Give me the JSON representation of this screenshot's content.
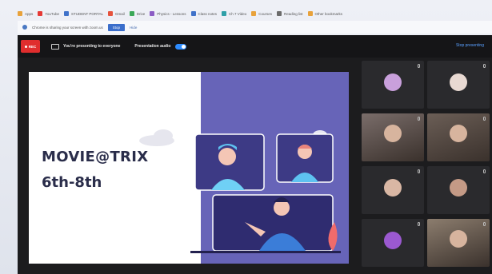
{
  "browser": {
    "bookmarks": [
      {
        "label": "Apps",
        "color": "#e8a23b"
      },
      {
        "label": "YouTube",
        "color": "#e53935"
      },
      {
        "label": "STUDENT PORTAL",
        "color": "#3f72c9"
      },
      {
        "label": "Gmail",
        "color": "#e5533d"
      },
      {
        "label": "Drive",
        "color": "#3aa757"
      },
      {
        "label": "Physics - Lessons",
        "color": "#8b5cc4"
      },
      {
        "label": "Class notes",
        "color": "#3f72c9"
      },
      {
        "label": "Ch 7 Video",
        "color": "#2fa0a8"
      },
      {
        "label": "Courses",
        "color": "#e8a23b"
      },
      {
        "label": "Reading list",
        "color": "#6b6b6b"
      },
      {
        "label": "Other bookmarks",
        "color": "#e8a23b"
      }
    ]
  },
  "notification": {
    "text": "Chrome is sharing your screen with zoom.us",
    "button": "Stop",
    "link": "Hide"
  },
  "zoom": {
    "rec_label": "REC",
    "presenting_text": "You're presenting to everyone",
    "audio_text": "Presentation audio",
    "stop_share": "Stop presenting"
  },
  "slide": {
    "title": "MOVIE@TRIX",
    "subtitle": "6th-8th"
  },
  "participants": [
    {
      "name": "",
      "kind": "avatar",
      "color": "#c9a0dc"
    },
    {
      "name": "",
      "kind": "avatar",
      "color": "#e8d9d2"
    },
    {
      "name": "",
      "kind": "video",
      "color": "#7a6d6a"
    },
    {
      "name": "",
      "kind": "video",
      "color": "#6b5e56"
    },
    {
      "name": "",
      "kind": "avatar",
      "color": "#d9b7a4"
    },
    {
      "name": "",
      "kind": "avatar",
      "color": "#c49a86"
    },
    {
      "name": "",
      "kind": "avatar",
      "color": "#9b59d0"
    },
    {
      "name": "",
      "kind": "video",
      "color": "#8c7d6e"
    }
  ],
  "colors": {
    "accent": "#2d8cff",
    "rec": "#e02d2d",
    "slide_purple": "#6764b8",
    "slide_text": "#2a2d4a"
  }
}
